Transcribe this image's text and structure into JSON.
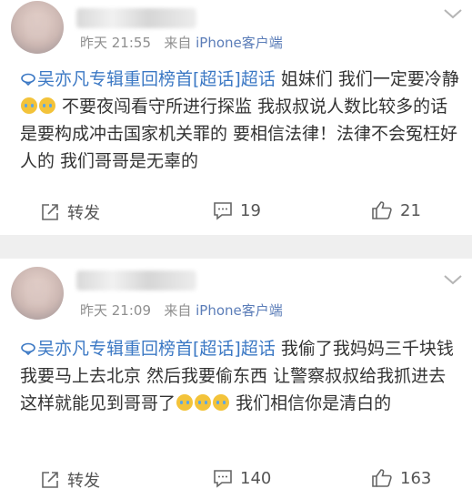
{
  "posts": [
    {
      "time": "昨天 21:55",
      "source_prefix": "来自",
      "source": "iPhone客户端",
      "topic": "吴亦凡专辑重回榜首[超话]超话",
      "text_parts": [
        "姐妹们 我们一定要冷静",
        "不要夜闯看守所进行探监 我叔叔说人数比较多的话 是要构成冲击国家机关罪的 要相信法律！法律不会冤枉好人的 我们哥哥是无辜的"
      ],
      "share_label": "转发",
      "comments": "19",
      "likes": "21"
    },
    {
      "time": "昨天 21:09",
      "source_prefix": "来自",
      "source": "iPhone客户端",
      "topic": "吴亦凡专辑重回榜首[超话]超话",
      "text_parts": [
        "我偷了我妈妈三千块钱 我要马上去北京 然后我要偷东西 让警察叔叔给我抓进去 这样就能见到哥哥了",
        "我们相信你是清白的"
      ],
      "share_label": "转发",
      "comments": "140",
      "likes": "163"
    }
  ],
  "colors": {
    "topic": "#3b78c4",
    "source": "#5b7db8",
    "divider": "#efefef"
  },
  "icons": {
    "share": "share-icon",
    "comment": "comment-icon",
    "like": "thumbs-up-icon",
    "more": "chevron-down-icon"
  }
}
